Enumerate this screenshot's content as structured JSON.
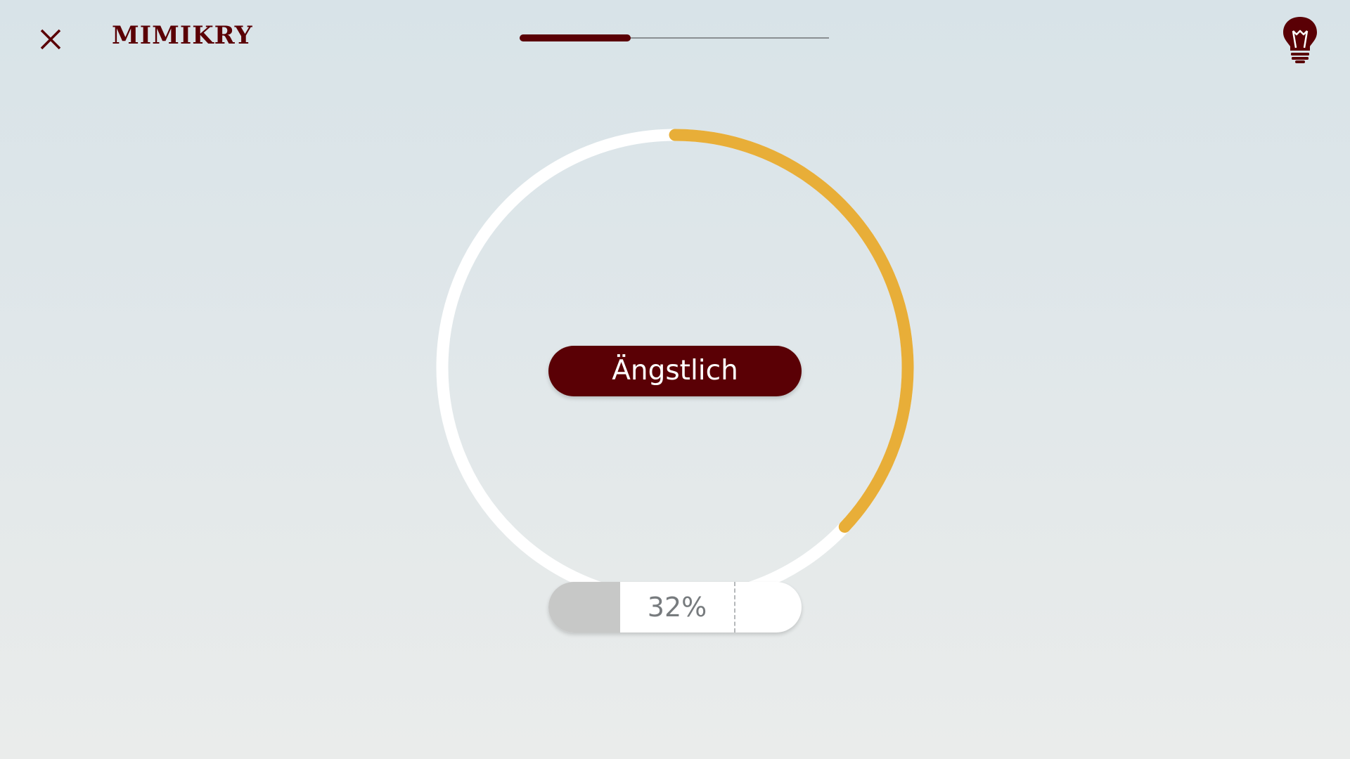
{
  "header": {
    "brand": "MIMIKRY",
    "close_icon": "close-icon",
    "hint_icon": "lightbulb-icon",
    "step_progress": 0.36
  },
  "exercise": {
    "emotion_label": "Ängstlich",
    "percent_text": "32%",
    "ring_progress": 0.37
  },
  "colors": {
    "brand": "#5a0005",
    "accent": "#e8ae38",
    "ring_track": "#ffffff"
  }
}
